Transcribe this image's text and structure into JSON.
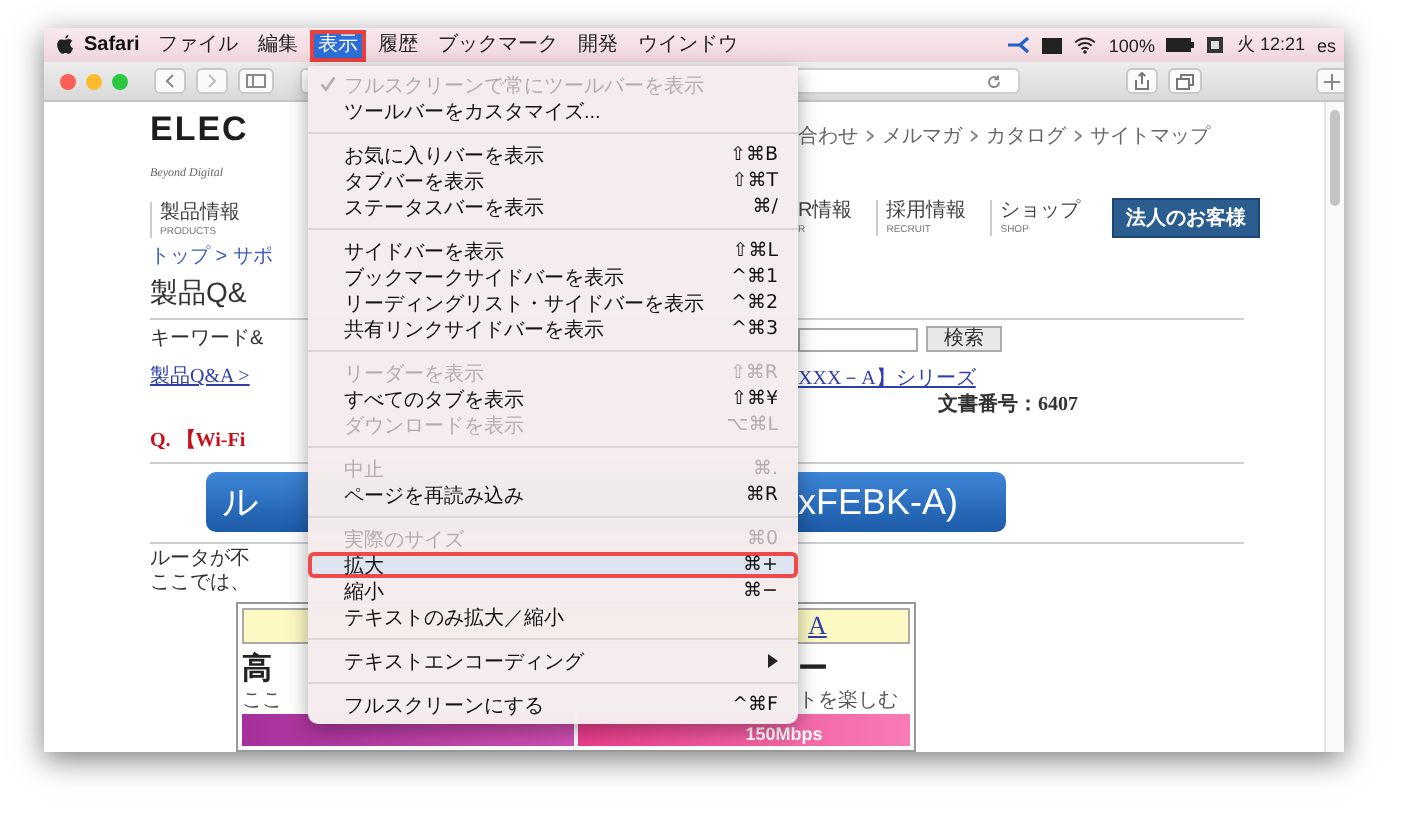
{
  "menu_bar": {
    "app": "Safari",
    "menus": [
      {
        "label": "ファイル",
        "selected": false
      },
      {
        "label": "編集",
        "selected": false
      },
      {
        "label": "表示",
        "selected": true
      },
      {
        "label": "履歴",
        "selected": false
      },
      {
        "label": "ブックマーク",
        "selected": false
      },
      {
        "label": "開発",
        "selected": false
      },
      {
        "label": "ウインドウ",
        "selected": false
      }
    ],
    "battery": "100%",
    "clock": "火 12:21",
    "user": "es"
  },
  "menu": {
    "sections": [
      {
        "items": [
          {
            "label": "フルスクリーンで常にツールバーを表示",
            "disabled": true,
            "checked": true,
            "highlighted": false,
            "submenu": false
          },
          {
            "label": "ツールバーをカスタマイズ...",
            "disabled": false,
            "checked": false,
            "highlighted": false,
            "submenu": false
          }
        ]
      },
      {
        "items": [
          {
            "label": "お気に入りバーを表示",
            "shortcut": "⇧⌘B",
            "disabled": false,
            "checked": false,
            "highlighted": false,
            "submenu": false
          },
          {
            "label": "タブバーを表示",
            "shortcut": "⇧⌘T",
            "disabled": false,
            "checked": false,
            "highlighted": false,
            "submenu": false
          },
          {
            "label": "ステータスバーを表示",
            "shortcut": "⌘/",
            "disabled": false,
            "checked": false,
            "highlighted": false,
            "submenu": false
          }
        ]
      },
      {
        "items": [
          {
            "label": "サイドバーを表示",
            "shortcut": "⇧⌘L",
            "disabled": false,
            "checked": false,
            "highlighted": false,
            "submenu": false
          },
          {
            "label": "ブックマークサイドバーを表示",
            "shortcut": "^⌘1",
            "disabled": false,
            "checked": false,
            "highlighted": false,
            "submenu": false
          },
          {
            "label": "リーディングリスト・サイドバーを表示",
            "shortcut": "^⌘2",
            "disabled": false,
            "checked": false,
            "highlighted": false,
            "submenu": false
          },
          {
            "label": "共有リンクサイドバーを表示",
            "shortcut": "^⌘3",
            "disabled": false,
            "checked": false,
            "highlighted": false,
            "submenu": false
          }
        ]
      },
      {
        "items": [
          {
            "label": "リーダーを表示",
            "shortcut": "⇧⌘R",
            "disabled": true,
            "checked": false,
            "highlighted": false,
            "submenu": false
          },
          {
            "label": "すべてのタブを表示",
            "shortcut": "⇧⌘¥",
            "disabled": false,
            "checked": false,
            "highlighted": false,
            "submenu": false
          },
          {
            "label": "ダウンロードを表示",
            "shortcut": "⌥⌘L",
            "disabled": true,
            "checked": false,
            "highlighted": false,
            "submenu": false
          }
        ]
      },
      {
        "items": [
          {
            "label": "中止",
            "shortcut": "⌘.",
            "disabled": true,
            "checked": false,
            "highlighted": false,
            "submenu": false
          },
          {
            "label": "ページを再読み込み",
            "shortcut": "⌘R",
            "disabled": false,
            "checked": false,
            "highlighted": false,
            "submenu": false
          }
        ]
      },
      {
        "items": [
          {
            "label": "実際のサイズ",
            "shortcut": "⌘0",
            "disabled": true,
            "checked": false,
            "highlighted": false,
            "submenu": false
          },
          {
            "label": "拡大",
            "shortcut": "⌘+",
            "disabled": false,
            "checked": false,
            "highlighted": true,
            "submenu": false
          },
          {
            "label": "縮小",
            "shortcut": "⌘−",
            "disabled": false,
            "checked": false,
            "highlighted": false,
            "submenu": false
          },
          {
            "label": "テキストのみ拡大／縮小",
            "disabled": false,
            "checked": false,
            "highlighted": false,
            "submenu": false
          }
        ]
      },
      {
        "items": [
          {
            "label": "テキストエンコーディング",
            "disabled": false,
            "checked": false,
            "highlighted": false,
            "submenu": true
          }
        ]
      },
      {
        "items": [
          {
            "label": "フルスクリーンにする",
            "shortcut": "^⌘F",
            "disabled": false,
            "checked": false,
            "highlighted": false,
            "submenu": false
          }
        ]
      }
    ]
  },
  "web_page": {
    "logo": "ELEC",
    "tagline": "Beyond Digital",
    "top_links": [
      "合わせ",
      "メルマガ",
      "カタログ",
      "サイトマップ"
    ],
    "nav_left": {
      "label": "製品情報",
      "sub": "PRODUCTS"
    },
    "nav_right": [
      {
        "label": "R情報",
        "sub": "R"
      },
      {
        "label": "採用情報",
        "sub": "RECRUIT"
      },
      {
        "label": "ショップ",
        "sub": "SHOP"
      }
    ],
    "corporate_button": "法人のお客様",
    "breadcrumb": "トップ > サポ",
    "heading": "製品Q&",
    "keyword_label": "キーワード&",
    "search_button": "検索",
    "link_left": "製品Q&A >",
    "link_right": "XXX－A】シリーズ",
    "doc_number": "文書番号：6407",
    "question": "Q. 【Wi-Fi",
    "banner_button": {
      "left": "ル",
      "right": "xFEBK-A)"
    },
    "intro": [
      "ルータが不",
      "ここでは、"
    ],
    "table": {
      "header": "A",
      "title_left": "高",
      "title_right": "ー",
      "caption_left": "ここ",
      "caption_right": "トを楽しむ",
      "speed": "150Mbps"
    }
  }
}
